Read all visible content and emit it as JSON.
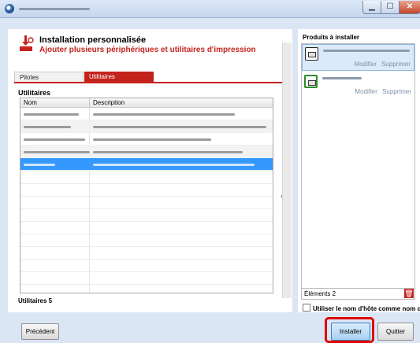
{
  "window": {
    "title": "",
    "min_glyph": "▁",
    "max_glyph": "☐",
    "close_glyph": "✕"
  },
  "header": {
    "title": "Installation personnalisée",
    "subtitle": "Ajouter plusieurs périphériques et utilitaires d'impression"
  },
  "tabs": [
    {
      "label": "Pilotes",
      "active": false
    },
    {
      "label": "Utilitaires",
      "active": true
    }
  ],
  "utilities": {
    "section_title": "Utilitaires",
    "columns": [
      "Nom",
      "Description"
    ],
    "count_label": "Utilitaires 5",
    "rows": [
      {
        "name": "",
        "description": "",
        "selected": false
      },
      {
        "name": "",
        "description": "",
        "selected": false
      },
      {
        "name": "",
        "description": "",
        "selected": false
      },
      {
        "name": "",
        "description": "",
        "selected": false
      },
      {
        "name": "",
        "description": "",
        "selected": true
      }
    ]
  },
  "products": {
    "title": "Produits à installer",
    "items": [
      {
        "name": "",
        "modify": "Modifier",
        "delete": "Supprimer",
        "selected": true
      },
      {
        "name": "",
        "modify": "Modifier",
        "delete": "Supprimer",
        "selected": false
      }
    ],
    "elements_label": "Éléments 2"
  },
  "options": {
    "hostname_checkbox": "Utiliser le nom d'hôte comme nom de port",
    "checked": false
  },
  "buttons": {
    "previous": "Précédent",
    "install": "Installer",
    "quit": "Quitter"
  },
  "colors": {
    "accent": "#c4231c",
    "selection": "#3399ff",
    "highlight_ring": "#e00000"
  }
}
